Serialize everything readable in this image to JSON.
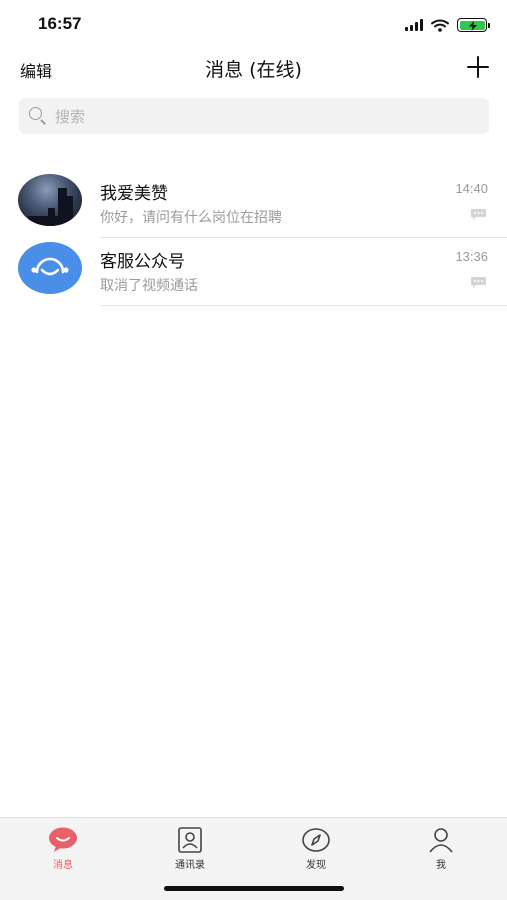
{
  "status_bar": {
    "time": "16:57"
  },
  "nav": {
    "edit_label": "编辑",
    "title": "消息 (在线)"
  },
  "search": {
    "placeholder": "搜索"
  },
  "conversations": [
    {
      "name": "我爱美赞",
      "preview": "你好，请问有什么岗位在招聘",
      "time": "14:40",
      "avatar": "photo-avatar"
    },
    {
      "name": "客服公众号",
      "preview": "取消了视频通话",
      "time": "13:36",
      "avatar": "customer-service-avatar"
    }
  ],
  "tabs": [
    {
      "label": "消息",
      "icon": "chat-bubble-icon",
      "active": true
    },
    {
      "label": "通讯录",
      "icon": "contacts-icon",
      "active": false
    },
    {
      "label": "发现",
      "icon": "compass-icon",
      "active": false
    },
    {
      "label": "我",
      "icon": "person-icon",
      "active": false
    }
  ],
  "colors": {
    "accent": "#e8606a",
    "service_avatar": "#4a8fe7",
    "battery": "#2dc84d"
  }
}
